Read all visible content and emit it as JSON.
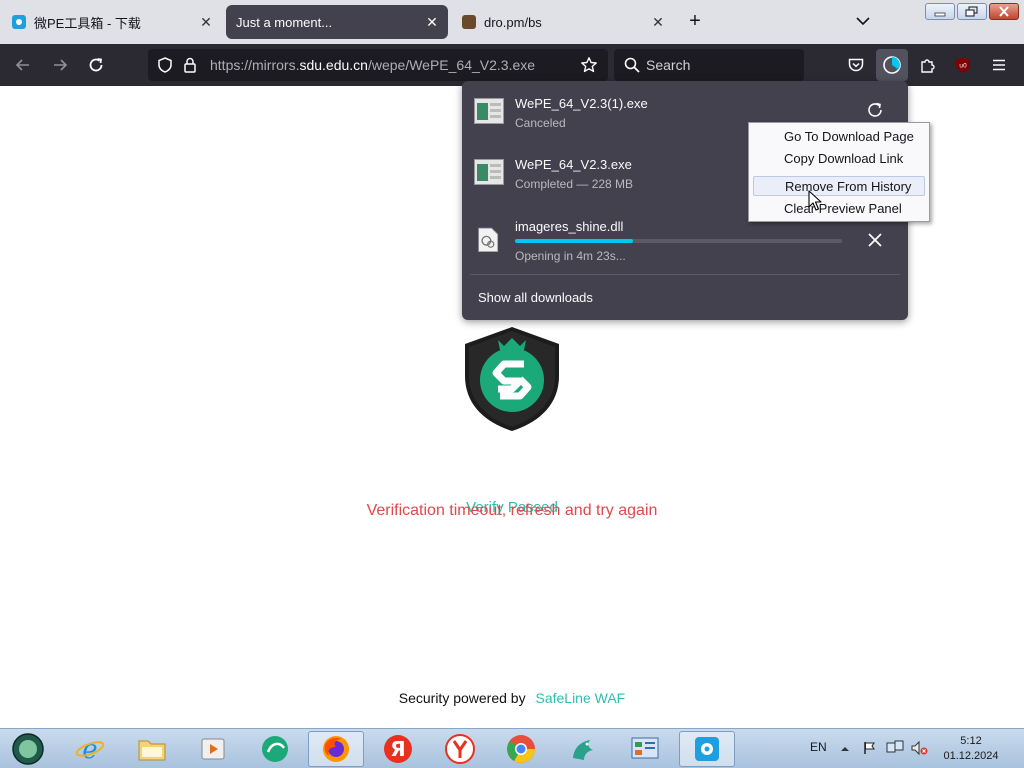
{
  "tabs": [
    {
      "title": "微PE工具箱 - 下载",
      "favicon_color": "#1ea0e0",
      "active": false
    },
    {
      "title": "Just a moment...",
      "active": true
    },
    {
      "title": "dro.pm/bs",
      "favicon_color": "#6a4a2a",
      "active": false
    }
  ],
  "toolbar": {
    "url_prefix": "https://mirrors.",
    "url_host": "sdu.edu.cn",
    "url_path": "/wepe/WePE_64_V2.3.exe",
    "search_placeholder": "Search"
  },
  "downloads": {
    "items": [
      {
        "name": "WePE_64_V2.3(1).exe",
        "status": "Canceled",
        "action": "retry-icon"
      },
      {
        "name": "WePE_64_V2.3.exe",
        "status": "Completed — 228 MB"
      },
      {
        "name": "imageres_shine.dll",
        "status": "Opening in 4m 23s...",
        "progress": 0.36,
        "action": "cancel-icon"
      }
    ],
    "show_all_label": "Show all downloads"
  },
  "context_menu": {
    "items": [
      "Go To Download Page",
      "Copy Download Link",
      "Remove From History",
      "Clear Preview Panel"
    ],
    "hovered_index": 2
  },
  "page": {
    "verify_passed": "Verify Passed",
    "error_message": "Verification timeout, refresh and try again",
    "footer_text": "Security powered by",
    "footer_brand": "SafeLine WAF"
  },
  "taskbar": {
    "language": "EN",
    "time": "5:12",
    "date": "01.12.2024"
  },
  "colors": {
    "accent": "#00c8f0",
    "brand": "#2cbfb0",
    "error": "#e0484a",
    "panel": "#42414d",
    "toolbar": "#2b2a33"
  }
}
